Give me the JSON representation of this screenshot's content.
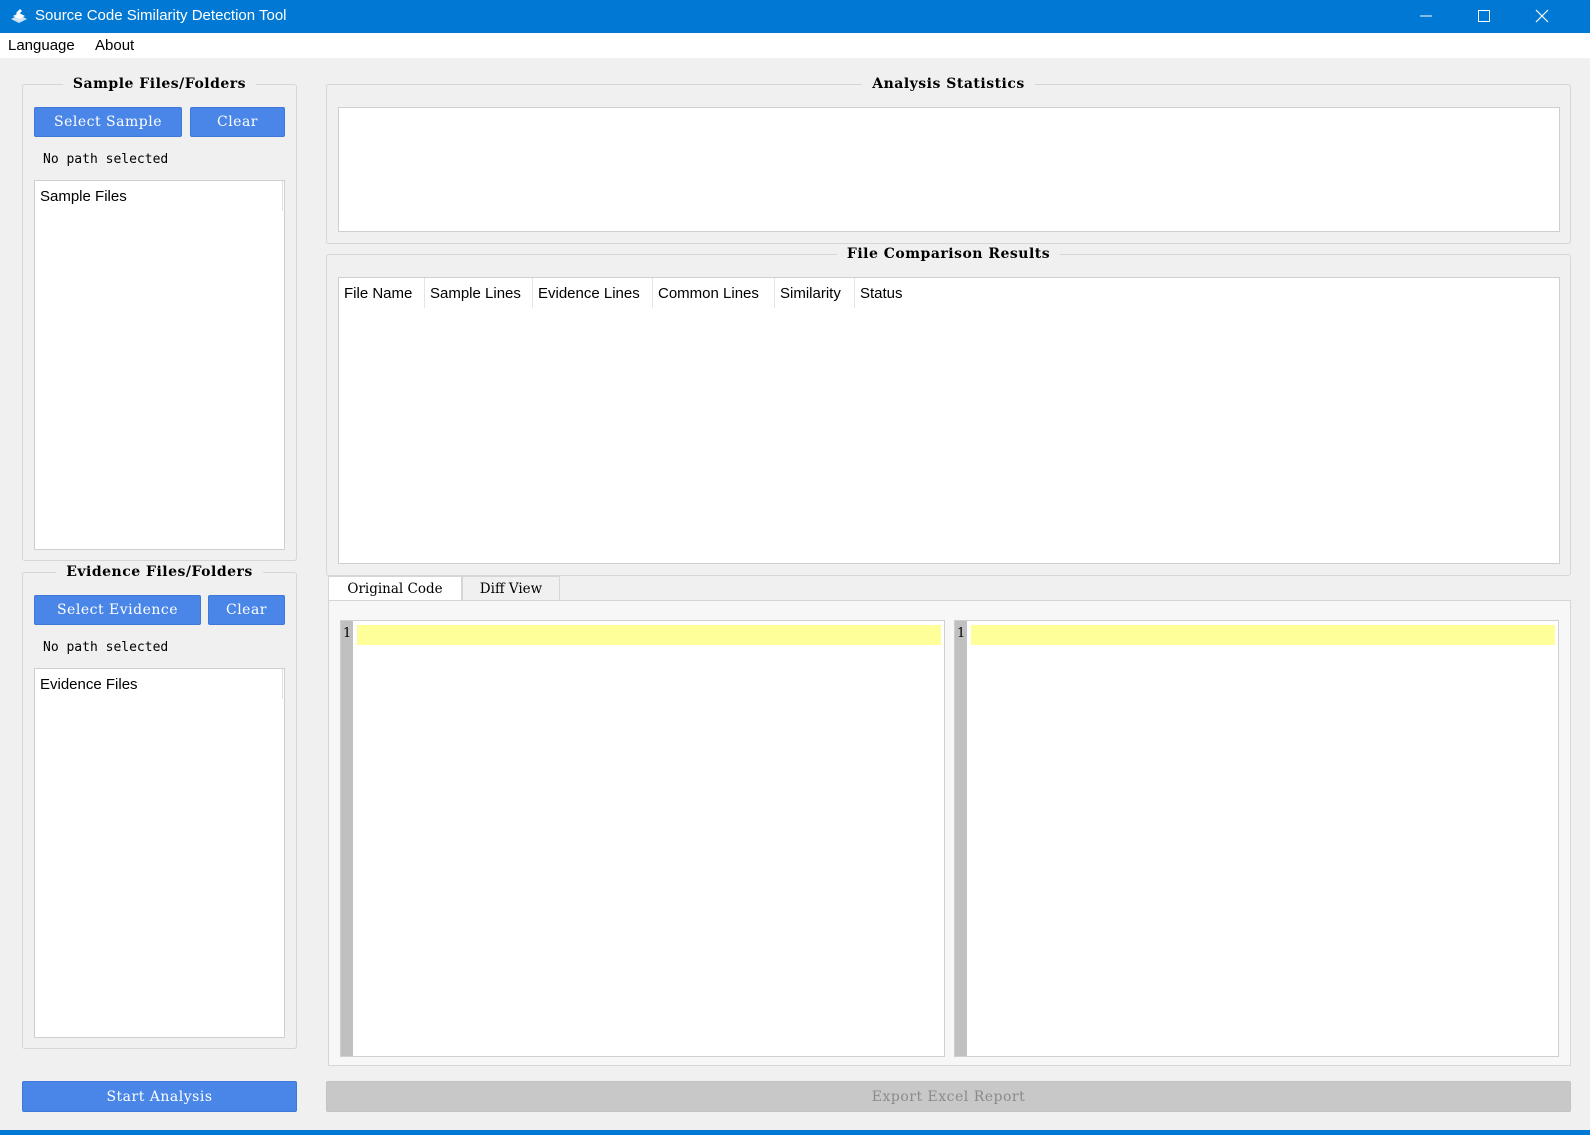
{
  "window": {
    "title": "Source Code Similarity Detection Tool",
    "accent_color": "#0078d4"
  },
  "menu": {
    "items": [
      "Language",
      "About"
    ]
  },
  "sample_group": {
    "title": "Sample Files/Folders",
    "select_label": "Select Sample",
    "clear_label": "Clear",
    "path_text": "No path selected",
    "list_header": "Sample Files"
  },
  "evidence_group": {
    "title": "Evidence Files/Folders",
    "select_label": "Select Evidence",
    "clear_label": "Clear",
    "path_text": "No path selected",
    "list_header": "Evidence Files"
  },
  "stats_group": {
    "title": "Analysis Statistics"
  },
  "results_group": {
    "title": "File Comparison Results",
    "columns": [
      "File Name",
      "Sample Lines",
      "Evidence Lines",
      "Common Lines",
      "Similarity",
      "Status"
    ]
  },
  "code_tabs": {
    "tabs": [
      "Original Code",
      "Diff View"
    ],
    "active": "Original Code",
    "left_editor": {
      "line_number": "1"
    },
    "right_editor": {
      "line_number": "1"
    },
    "highlight_color": "#ffff99"
  },
  "actions": {
    "start_label": "Start Analysis",
    "export_label": "Export Excel Report",
    "button_color": "#4a86e8"
  }
}
